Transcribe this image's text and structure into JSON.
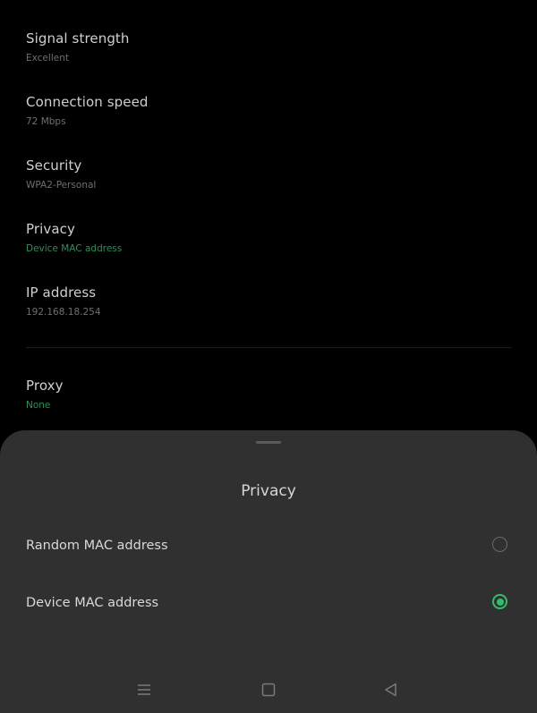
{
  "settings": {
    "signal": {
      "title": "Signal strength",
      "value": "Excellent"
    },
    "speed": {
      "title": "Connection speed",
      "value": "72 Mbps"
    },
    "security": {
      "title": "Security",
      "value": "WPA2-Personal"
    },
    "privacy": {
      "title": "Privacy",
      "value": "Device MAC address"
    },
    "ip": {
      "title": "IP address",
      "value": "192.168.18.254"
    },
    "proxy": {
      "title": "Proxy",
      "value": "None"
    }
  },
  "sheet": {
    "title": "Privacy",
    "options": [
      {
        "label": "Random MAC address",
        "selected": false
      },
      {
        "label": "Device MAC address",
        "selected": true
      }
    ]
  },
  "nav": {
    "menu_icon": "menu-icon",
    "home_icon": "home-icon",
    "back_icon": "back-icon"
  },
  "colors": {
    "accent": "#2fbf6a",
    "accent_text": "#2f8f56",
    "sheet_bg": "#303030",
    "background": "#000000"
  }
}
